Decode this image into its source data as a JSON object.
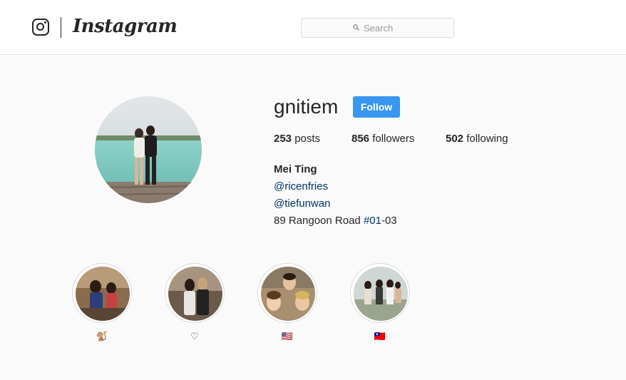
{
  "header": {
    "logo_text": "Instagram",
    "search_placeholder": "Search"
  },
  "profile": {
    "username": "gnitiem",
    "follow_label": "Follow",
    "stats": {
      "posts_count": "253",
      "posts_label": "posts",
      "followers_count": "856",
      "followers_label": "followers",
      "following_count": "502",
      "following_label": "following"
    },
    "bio": {
      "name": "Mei Ting",
      "mention_1": "@ricenfries",
      "mention_2": "@tiefunwan",
      "address_prefix": "89 Rangoon Road ",
      "address_hashtag": "#01",
      "address_suffix": "-03"
    }
  },
  "highlights": [
    {
      "label": "🐒"
    },
    {
      "label": "♡"
    },
    {
      "label": "🇺🇸"
    },
    {
      "label": "🇹🇼"
    }
  ],
  "colors": {
    "accent": "#3897f0",
    "link": "#003569",
    "border": "#dbdbdb"
  }
}
